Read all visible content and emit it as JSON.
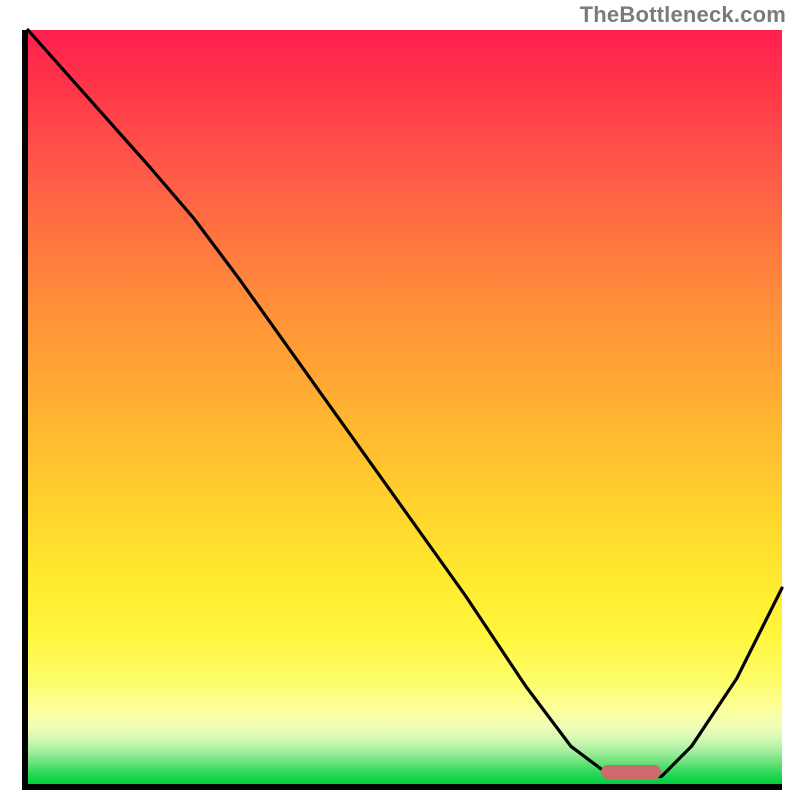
{
  "attribution": "TheBottleneck.com",
  "colors": {
    "axis": "#000000",
    "curve": "#000000",
    "valley_bar": "#cd6b6c",
    "gradient_stops": [
      "#ff1e50",
      "#ff3a47",
      "#ff574a",
      "#ff7340",
      "#ff8e3a",
      "#ffa434",
      "#ffbb30",
      "#ffd22e",
      "#ffe82f",
      "#fff53b",
      "#fdfd66",
      "#fcfe9a",
      "#f1fdb8",
      "#d3f9b3",
      "#a9f0a1",
      "#6fe37e",
      "#30d85a",
      "#00cf3e"
    ]
  },
  "chart_data": {
    "type": "line",
    "title": "",
    "xlabel": "",
    "ylabel": "",
    "xlim": [
      0,
      100
    ],
    "ylim": [
      0,
      100
    ],
    "comment": "Axes are unlabeled in the source image; x and y are expressed as 0–100 percent of the plotting area. y=0 is the bottom (green), y=100 is the top (red).",
    "series": [
      {
        "name": "bottleneck-curve",
        "x": [
          0,
          8,
          16,
          22,
          28,
          38,
          48,
          58,
          66,
          72,
          76,
          80,
          84,
          88,
          94,
          100
        ],
        "y": [
          100,
          91,
          82,
          75,
          67,
          53,
          39,
          25,
          13,
          5,
          2,
          1,
          1,
          5,
          14,
          26
        ]
      }
    ],
    "annotations": [
      {
        "name": "valley-marker",
        "shape": "rounded-bar",
        "color": "#cd6b6c",
        "x_start": 76,
        "x_end": 84,
        "y": 1.6
      }
    ]
  }
}
